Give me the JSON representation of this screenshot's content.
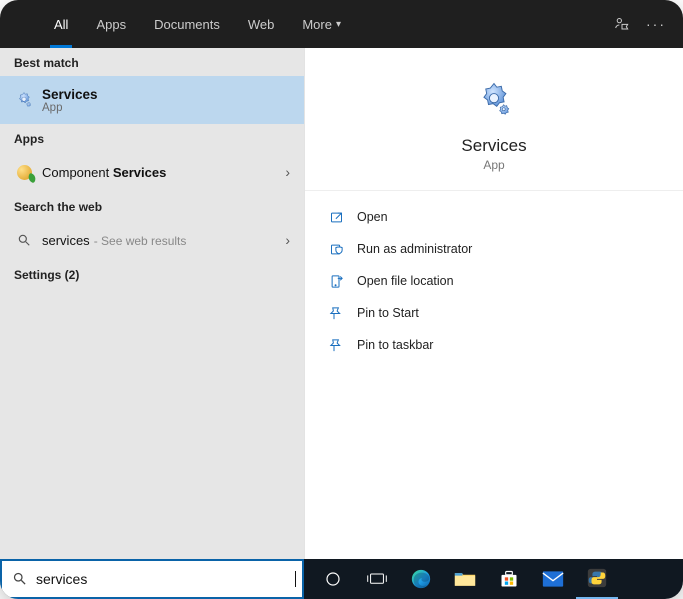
{
  "topbar": {
    "tabs": [
      {
        "label": "All",
        "active": true
      },
      {
        "label": "Apps"
      },
      {
        "label": "Documents"
      },
      {
        "label": "Web"
      },
      {
        "label": "More",
        "dropdown": true
      }
    ]
  },
  "left": {
    "best_match_header": "Best match",
    "best_match": {
      "title": "Services",
      "subtitle": "App"
    },
    "apps_header": "Apps",
    "apps": [
      {
        "prefix": "Component ",
        "bold": "Services"
      }
    ],
    "web_header": "Search the web",
    "web": [
      {
        "query": "services",
        "hint": "- See web results"
      }
    ],
    "settings_header": "Settings (2)"
  },
  "right": {
    "title": "Services",
    "subtitle": "App",
    "actions": [
      {
        "id": "open",
        "label": "Open"
      },
      {
        "id": "admin",
        "label": "Run as administrator"
      },
      {
        "id": "location",
        "label": "Open file location"
      },
      {
        "id": "pin-start",
        "label": "Pin to Start"
      },
      {
        "id": "pin-taskbar",
        "label": "Pin to taskbar"
      }
    ]
  },
  "taskbar": {
    "search_value": "services"
  }
}
